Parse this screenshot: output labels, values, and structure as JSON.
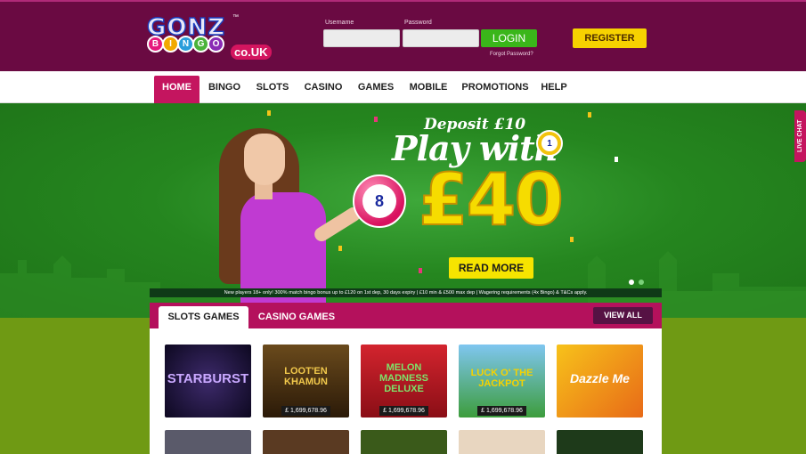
{
  "header": {
    "logo": {
      "line1": "GONZ",
      "balls": [
        "B",
        "I",
        "N",
        "G",
        "O"
      ],
      "suffix": "co.UK",
      "tm": "™"
    },
    "username_label": "Username",
    "password_label": "Password",
    "login_label": "LOGIN",
    "forgot_label": "Forgot Password?",
    "register_label": "REGISTER"
  },
  "nav": {
    "items": [
      {
        "label": "HOME",
        "active": true
      },
      {
        "label": "BINGO"
      },
      {
        "label": "SLOTS"
      },
      {
        "label": "CASINO"
      },
      {
        "label": "GAMES"
      },
      {
        "label": "MOBILE"
      },
      {
        "label": "PROMOTIONS"
      },
      {
        "label": "HELP"
      }
    ]
  },
  "hero": {
    "deposit_text": "Deposit £10",
    "play_text": "Play with",
    "amount_text": "£40",
    "big_ball_number": "8",
    "small_ball_number": "1",
    "cta_label": "READ MORE",
    "slides": 2,
    "active_slide": 1,
    "disclaimer": "New players 18+ only! 300% match bingo bonus up to £120 on 1st dep, 30 days expiry | £10 min & £500 max dep | Wagering requirements (4x Bingo) & T&Cs apply."
  },
  "live_chat_label": "LIVE CHAT",
  "games": {
    "tabs": [
      {
        "label": "SLOTS GAMES",
        "active": true
      },
      {
        "label": "CASINO GAMES"
      }
    ],
    "view_all_label": "VIEW ALL",
    "tiles": [
      {
        "title": "STARBURST",
        "jackpot": ""
      },
      {
        "title": "LOOT'EN KHAMUN",
        "jackpot": "£ 1,699,678.96"
      },
      {
        "title": "MELON MADNESS DELUXE",
        "jackpot": "£ 1,699,678.96"
      },
      {
        "title": "LUCK O' THE JACKPOT",
        "jackpot": "£ 1,699,678.96"
      },
      {
        "title": "Dazzle Me",
        "jackpot": ""
      }
    ]
  },
  "colors": {
    "header_bg": "#6a0a42",
    "accent_pink": "#c4155f",
    "login_green": "#3ab61a",
    "register_yellow": "#f6d200",
    "hero_green": "#25861f",
    "page_green": "#6f9a14"
  }
}
